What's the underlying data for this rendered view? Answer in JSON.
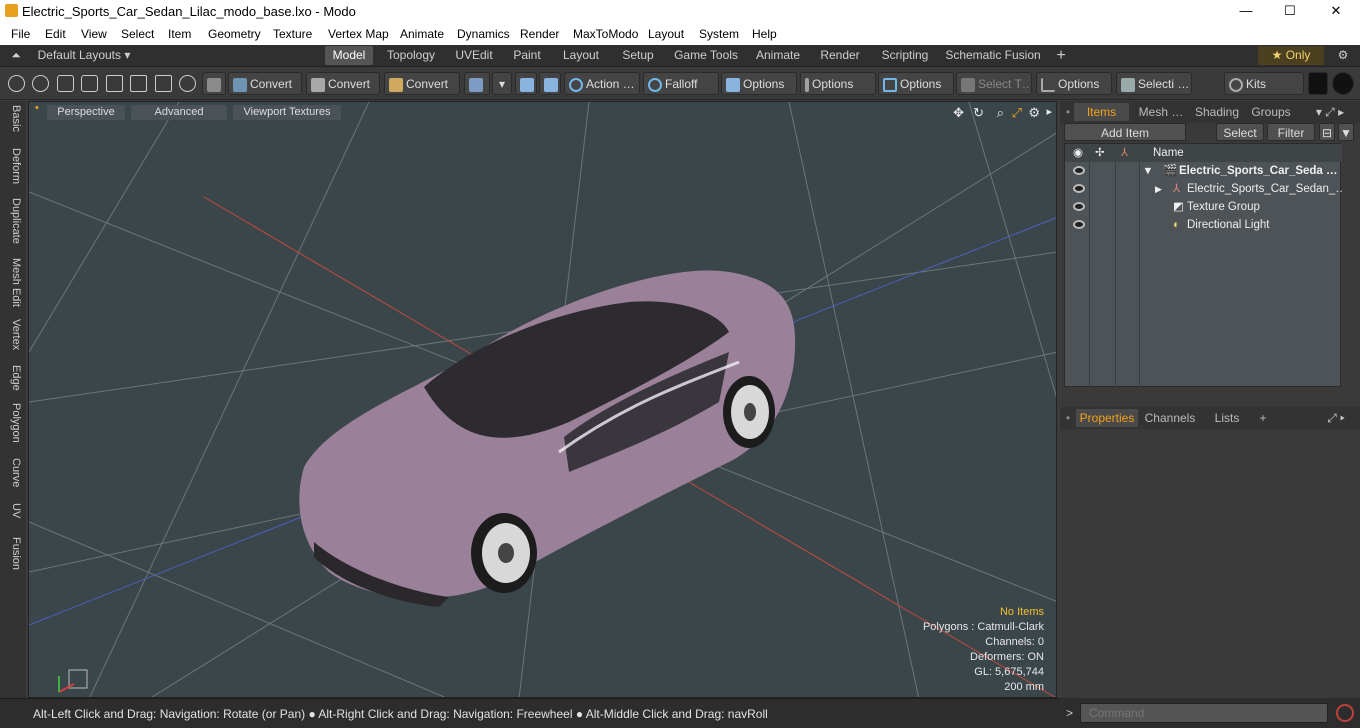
{
  "window": {
    "title": "Electric_Sports_Car_Sedan_Lilac_modo_base.lxo - Modo",
    "minimize": "—",
    "maximize": "☐",
    "close": "✕"
  },
  "menu": [
    "File",
    "Edit",
    "View",
    "Select",
    "Item",
    "Geometry",
    "Texture",
    "Vertex Map",
    "Animate",
    "Dynamics",
    "Render",
    "MaxToModo",
    "Layout",
    "System",
    "Help"
  ],
  "layouts": {
    "default_label": "Default Layouts ▾",
    "tabs": [
      "Model",
      "Topology",
      "UVEdit",
      "Paint",
      "Layout",
      "Setup",
      "Game Tools",
      "Animate",
      "Render",
      "Scripting",
      "Schematic Fusion"
    ],
    "active": "Model",
    "add": "+",
    "only_label": "★ Only"
  },
  "toolbar": {
    "convert1": "Convert",
    "convert2": "Convert",
    "convert3": "Convert",
    "action": "Action …",
    "falloff": "Falloff",
    "options1": "Options",
    "options2": "Options",
    "options3": "Options",
    "select_t": "Select T…",
    "options4": "Options",
    "selecti": "Selecti …",
    "kits": "Kits"
  },
  "left_tabs": [
    "Basic",
    "Deform",
    "Duplicate",
    "Mesh Edit",
    "Vertex",
    "Edge",
    "Polygon",
    "Curve",
    "UV",
    "Fusion"
  ],
  "viewport": {
    "perspective": "Perspective",
    "advanced": "Advanced",
    "textures": "Viewport Textures",
    "info": {
      "no_items": "No Items",
      "polygons": "Polygons : Catmull-Clark",
      "channels": "Channels: 0",
      "deformers": "Deformers: ON",
      "gl": "GL: 5,675,744",
      "scale": "200 mm"
    }
  },
  "items_panel": {
    "tabs": [
      "Items",
      "Mesh …",
      "Shading",
      "Groups"
    ],
    "add_item": "Add Item",
    "select": "Select",
    "filter": "Filter",
    "name_header": "Name",
    "rows": [
      {
        "label": "Electric_Sports_Car_Seda …",
        "icon": "scene-icon"
      },
      {
        "label": "Electric_Sports_Car_Sedan_…",
        "icon": "mesh-locator-icon"
      },
      {
        "label": "Texture Group",
        "icon": "texture-group-icon"
      },
      {
        "label": "Directional Light",
        "icon": "light-icon"
      }
    ]
  },
  "properties_panel": {
    "tabs": [
      "Properties",
      "Channels",
      "Lists"
    ],
    "add": "+"
  },
  "status": {
    "message": "Alt-Left Click and Drag: Navigation: Rotate (or Pan) ● Alt-Right Click and Drag: Navigation: Freewheel ● Alt-Middle Click and Drag: navRoll"
  },
  "command": {
    "placeholder": "Command"
  },
  "colors": {
    "accent": "#f3a21c",
    "car_body": "#9a8199",
    "viewport_bg": "#3b464b"
  }
}
